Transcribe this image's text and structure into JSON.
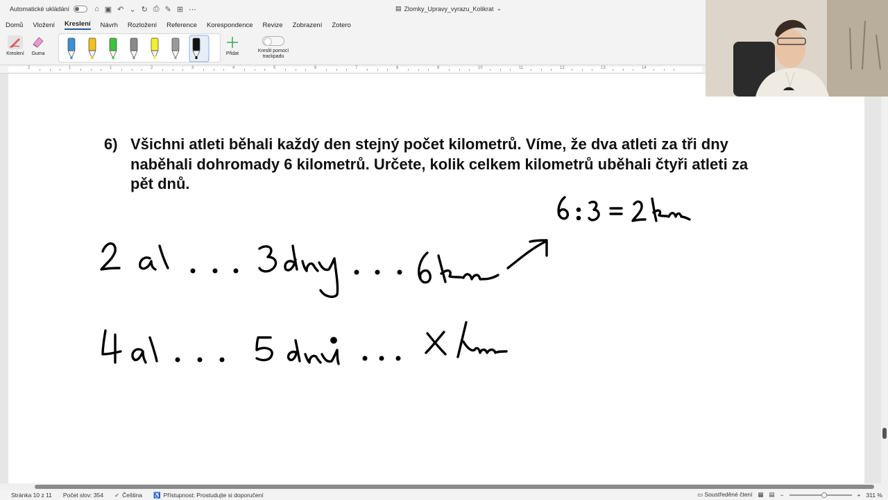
{
  "titlebar": {
    "autosave_label": "Automatické ukládání",
    "document_title": "Zlomky_Upravy_vyrazu_Kolikrat",
    "quick_access_icons": [
      "home-icon",
      "save-icon",
      "undo-icon",
      "redo-icon",
      "print-icon",
      "edit-icon",
      "more-icon"
    ]
  },
  "tabs": [
    "Domů",
    "Vložení",
    "Kreslení",
    "Návrh",
    "Rozložení",
    "Reference",
    "Korespondence",
    "Revize",
    "Zobrazení",
    "Zotero"
  ],
  "active_tab": "Kreslení",
  "ribbon": {
    "drawing_label": "Kreslení",
    "eraser_label": "Guma",
    "add_label": "Přidat",
    "trackpad_label": "Kreslit pomocí trackpadu",
    "pen_colors": [
      "#3a8fd6",
      "#f2c21b",
      "#3cc43c",
      "#8a8a8a",
      "#f5ef2e",
      "#9a9a9a",
      "#111111"
    ]
  },
  "ruler": {
    "numbers": [
      "2",
      "1",
      "1",
      "2",
      "3",
      "4",
      "5",
      "6",
      "7",
      "8",
      "9",
      "10",
      "11",
      "12",
      "13",
      "14"
    ]
  },
  "document": {
    "question_number": "6)",
    "question_text": "Všichni atleti běhali každý den stejný počet kilometrů. Víme, že dva atleti za tři dny naběhali dohromady 6 kilometrů. Určete, kolik celkem kilometrů uběhali čtyři atleti za pět dnů.",
    "ink_color": "#000000"
  },
  "statusbar": {
    "page": "Stránka 10 z 11",
    "word_count": "Počet slov: 354",
    "language": "Čeština",
    "accessibility": "Přístupnost: Prostudujte si doporučení",
    "focus": "Soustředěné čtení",
    "zoom": "311 %"
  }
}
